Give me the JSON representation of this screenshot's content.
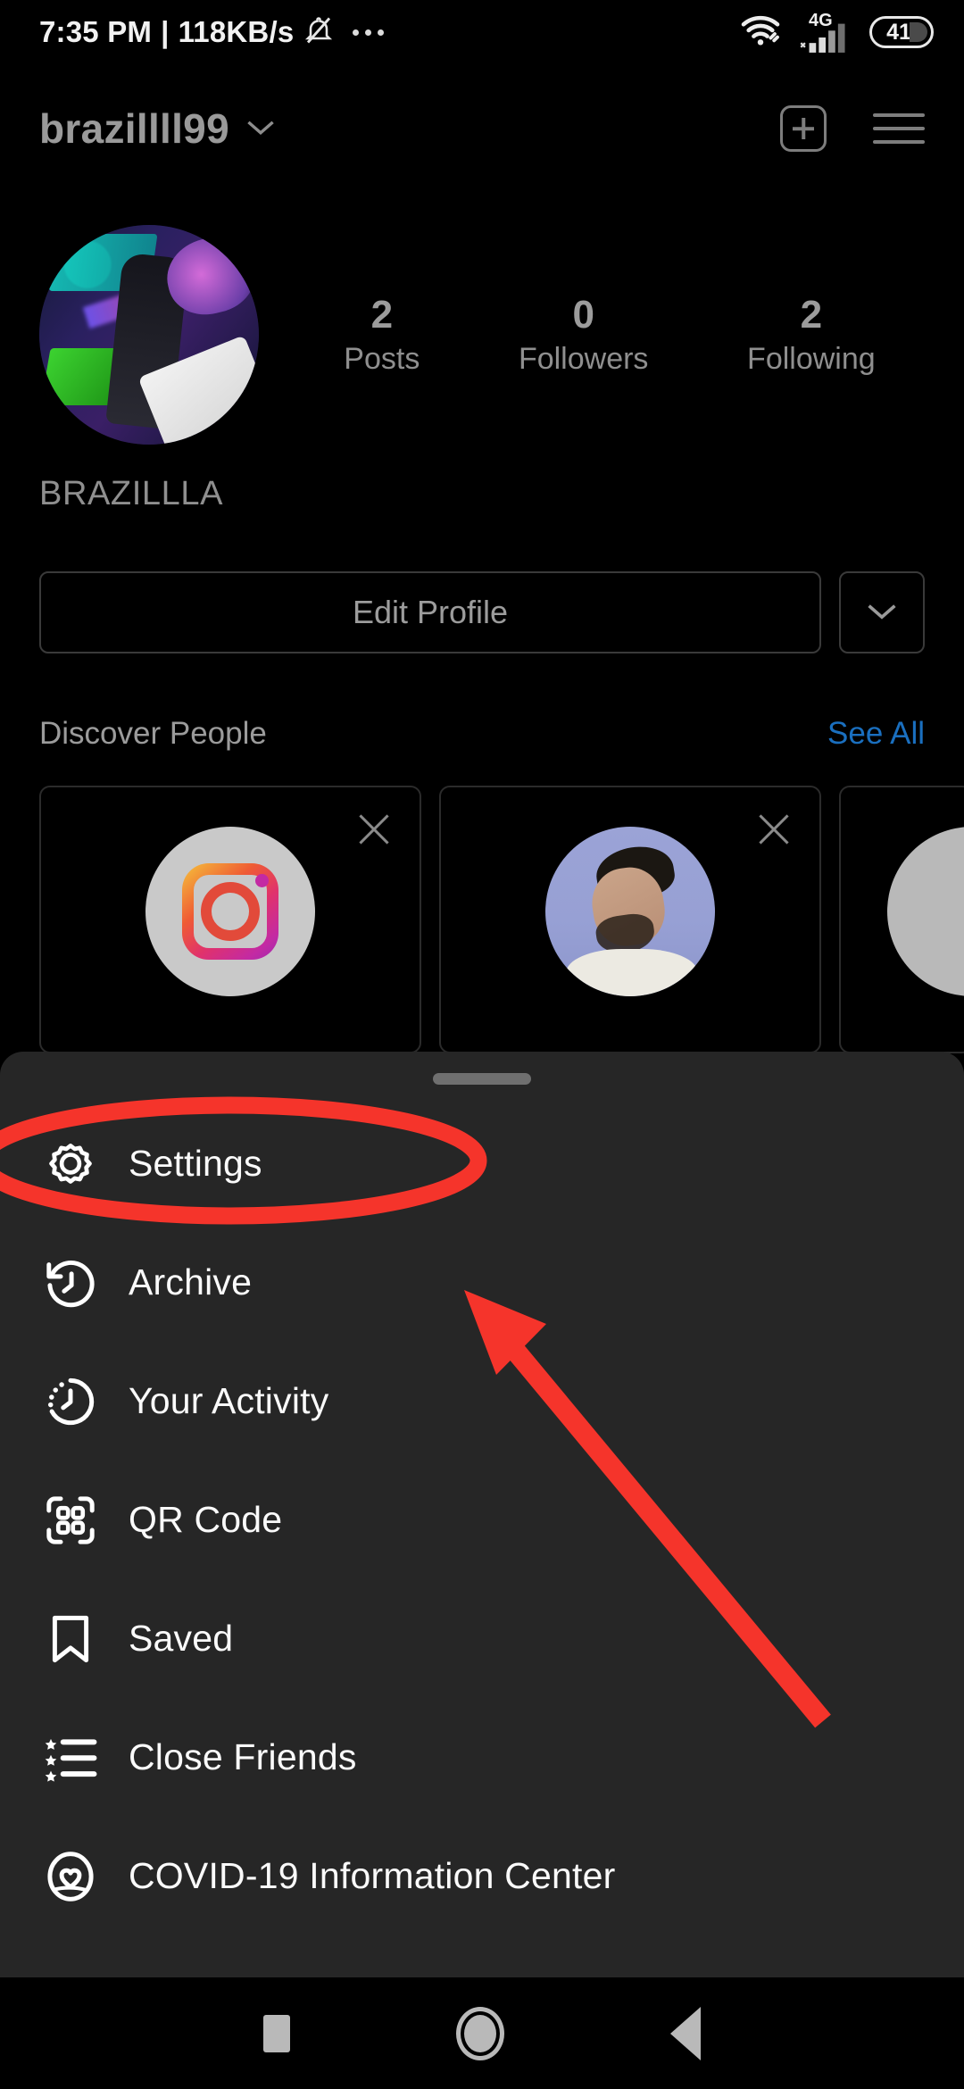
{
  "status_bar": {
    "time": "7:35 PM",
    "separator": "|",
    "network_speed": "118KB/s",
    "mute_icon": "bell-muted-icon",
    "overflow_icon": "more-dots-icon",
    "wifi_icon": "wifi-icon",
    "network_type": "4G",
    "signal_icon": "signal-bars-icon",
    "battery_level": "41"
  },
  "header": {
    "username": "brazillll99",
    "username_chevron_icon": "chevron-down-icon",
    "add_icon": "plus-square-icon",
    "menu_icon": "hamburger-menu-icon"
  },
  "profile": {
    "avatar_name": "profile-avatar",
    "display_name": "BRAZILLLA",
    "stats": [
      {
        "num": "2",
        "label": "Posts"
      },
      {
        "num": "0",
        "label": "Followers"
      },
      {
        "num": "2",
        "label": "Following"
      }
    ],
    "edit_profile_label": "Edit Profile",
    "more_chevron_icon": "chevron-down-icon"
  },
  "discover": {
    "title": "Discover People",
    "see_all_label": "See All",
    "cards": [
      {
        "avatar": "instagram-logo-avatar",
        "dismiss_icon": "close-icon"
      },
      {
        "avatar": "person-photo-avatar",
        "dismiss_icon": "close-icon"
      },
      {
        "avatar": "gray-person-avatar",
        "dismiss_icon": "close-icon"
      }
    ]
  },
  "sheet": {
    "handle": "drag-handle",
    "items": [
      {
        "label": "Settings",
        "icon": "gear-icon"
      },
      {
        "label": "Archive",
        "icon": "clock-rewind-icon"
      },
      {
        "label": "Your Activity",
        "icon": "activity-clock-icon"
      },
      {
        "label": "QR Code",
        "icon": "qr-code-icon"
      },
      {
        "label": "Saved",
        "icon": "bookmark-icon"
      },
      {
        "label": "Close Friends",
        "icon": "star-list-icon"
      },
      {
        "label": "COVID-19 Information Center",
        "icon": "heart-shield-icon"
      }
    ]
  },
  "annotations": {
    "highlight_color": "#F5342B",
    "ellipse_target": "Settings",
    "arrow_target": "Settings"
  },
  "navigation_bar": {
    "recents_icon": "square-icon",
    "home_icon": "circle-icon",
    "back_icon": "triangle-back-icon"
  },
  "colors": {
    "background": "#000000",
    "sheet_background": "#262626",
    "link_blue": "#1A6FBF",
    "muted_text": "#8F8F8F"
  }
}
